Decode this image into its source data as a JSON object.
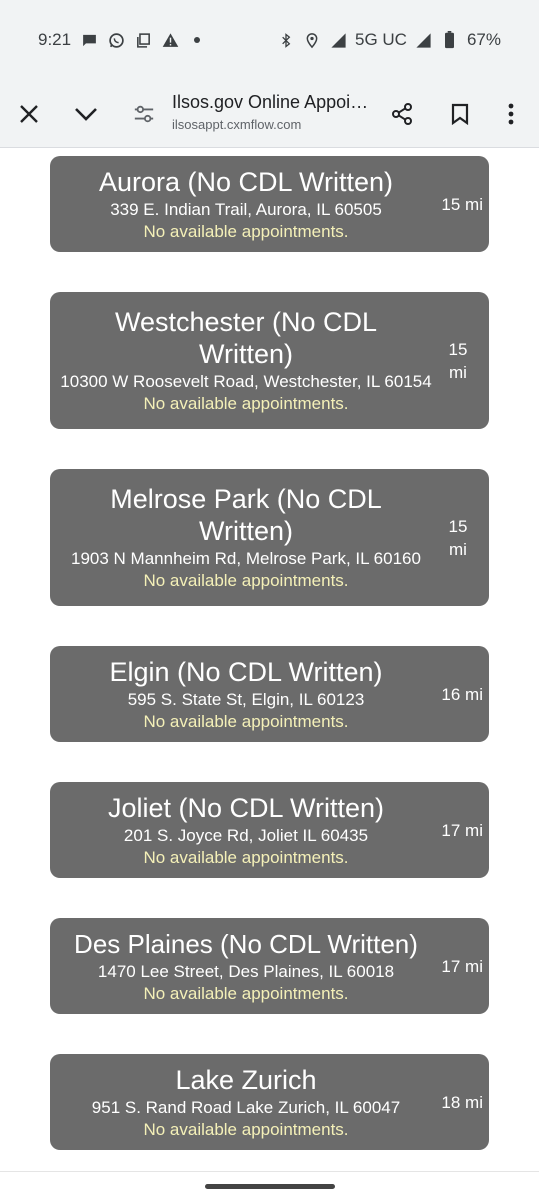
{
  "status_bar": {
    "time": "9:21",
    "network": "5G UC",
    "battery": "67%"
  },
  "toolbar": {
    "title": "Ilsos.gov Online Appoi…",
    "url": "ilsosappt.cxmflow.com"
  },
  "locations": [
    {
      "name": "Aurora (No CDL Written)",
      "address": "339 E. Indian Trail, Aurora, IL 60505",
      "status": "No available appointments.",
      "distance": "15 mi"
    },
    {
      "name": "Westchester (No CDL Written)",
      "address": "10300 W Roosevelt Road, Westchester, IL 60154",
      "status": "No available appointments.",
      "distance": "15 mi"
    },
    {
      "name": "Melrose Park (No CDL Written)",
      "address": "1903 N Mannheim Rd, Melrose Park, IL 60160",
      "status": "No available appointments.",
      "distance": "15 mi"
    },
    {
      "name": "Elgin (No CDL Written)",
      "address": "595 S. State St, Elgin, IL 60123",
      "status": "No available appointments.",
      "distance": "16 mi"
    },
    {
      "name": "Joliet (No CDL Written)",
      "address": "201 S. Joyce Rd, Joliet IL 60435",
      "status": "No available appointments.",
      "distance": "17 mi"
    },
    {
      "name": "Des Plaines (No CDL Written)",
      "address": "1470 Lee Street, Des Plaines, IL 60018",
      "status": "No available appointments.",
      "distance": "17 mi"
    },
    {
      "name": "Lake Zurich",
      "address": "951 S. Rand Road Lake Zurich, IL 60047",
      "status": "No available appointments.",
      "distance": "18 mi"
    }
  ]
}
